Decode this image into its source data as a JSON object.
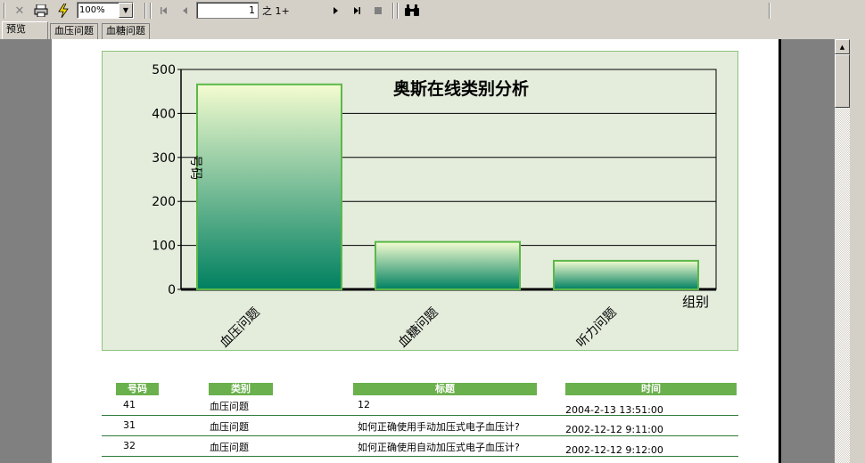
{
  "toolbar": {
    "zoom": "100%",
    "page_current": "1",
    "page_of": "之 1+"
  },
  "tabs": [
    "预览",
    "血压问题",
    "血糖问题"
  ],
  "chart_data": {
    "type": "bar",
    "title": "奥斯在线类别分析",
    "xlabel": "组别",
    "ylabel": "号码",
    "categories": [
      "血压问题",
      "血糖问题",
      "听力问题"
    ],
    "values": [
      466,
      108,
      65
    ],
    "ylim": [
      0,
      500
    ],
    "yticks": [
      "0",
      "100",
      "200",
      "300",
      "400",
      "500"
    ],
    "grid": true,
    "colors": {
      "bar_top": "#f4fcd0",
      "bar_bottom": "#008060",
      "bar_border": "#5cb84a",
      "plot_bg": "#e4ecdc"
    }
  },
  "table": {
    "headers": [
      "号码",
      "类别",
      "标题",
      "时间"
    ],
    "rows": [
      {
        "id": "41",
        "category": "血压问题",
        "title": "12",
        "time": "2004-2-13  13:51:00"
      },
      {
        "id": "31",
        "category": "血压问题",
        "title": "如何正确使用手动加压式电子血压计?",
        "time": "2002-12-12    9:11:00"
      },
      {
        "id": "32",
        "category": "血压问题",
        "title": "如何正确使用自动加压式电子血压计?",
        "time": "2002-12-12    9:12:00"
      }
    ]
  },
  "colors": {
    "accent": "#6ab04c",
    "row_line": "#2d7a3a"
  }
}
